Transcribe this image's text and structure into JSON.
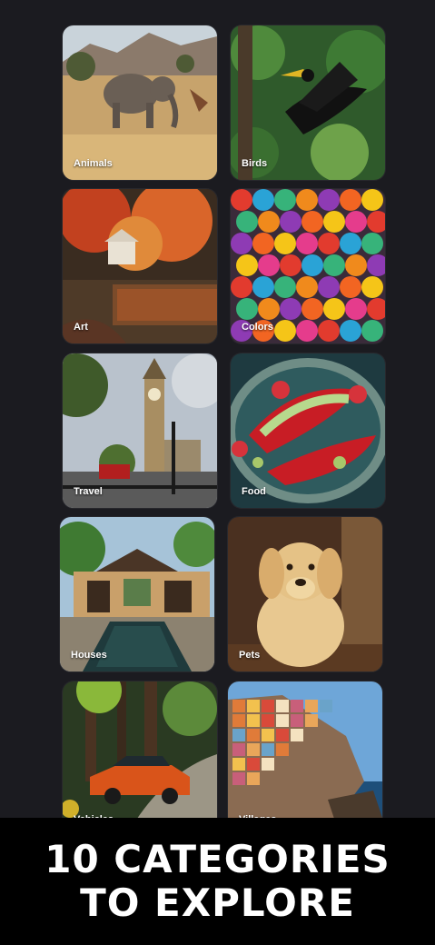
{
  "categories": [
    {
      "label": "Animals",
      "image": "elephant-savanna-photo"
    },
    {
      "label": "Birds",
      "image": "hornbill-jungle-photo"
    },
    {
      "label": "Art",
      "image": "autumn-park-painting"
    },
    {
      "label": "Colors",
      "image": "colorful-umbrellas-photo"
    },
    {
      "label": "Travel",
      "image": "big-ben-london-photo"
    },
    {
      "label": "Food",
      "image": "strawberry-dessert-photo"
    },
    {
      "label": "Houses",
      "image": "tropical-villa-pool-photo"
    },
    {
      "label": "Pets",
      "image": "golden-retriever-photo"
    },
    {
      "label": "Vehicles",
      "image": "orange-car-forest-photo"
    },
    {
      "label": "Villages",
      "image": "cliffside-village-photo"
    }
  ],
  "banner": {
    "text": "10 CATEGORIES TO EXPLORE"
  },
  "colors": {
    "background": "#1b1b20",
    "banner_background": "#000000",
    "text": "#ffffff"
  }
}
